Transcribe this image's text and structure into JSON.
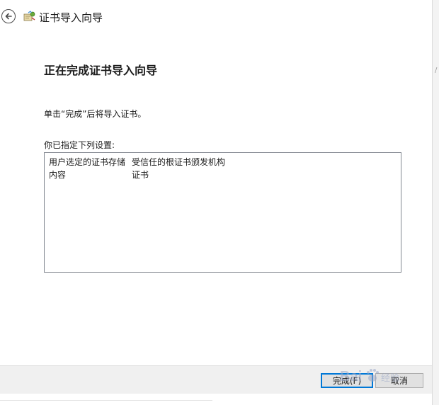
{
  "wizard": {
    "title": "证书导入向导",
    "icon": "certificate-wizard-icon",
    "back_icon": "back-arrow-icon"
  },
  "main": {
    "heading": "正在完成证书导入向导",
    "instruction": "单击“完成”后将导入证书。",
    "settings_label": "你已指定下列设置:",
    "settings": [
      {
        "key": "用户选定的证书存储",
        "value": "受信任的根证书颁发机构"
      },
      {
        "key": "内容",
        "value": "证书"
      }
    ]
  },
  "footer": {
    "finish_label": "完成(F)",
    "cancel_label": "取消"
  },
  "colors": {
    "default_button_border": "#0078d7",
    "footer_bg": "#f0f0f0"
  },
  "watermark": {
    "text": "Bai 经验",
    "icon": "baidu-paw-logo"
  }
}
